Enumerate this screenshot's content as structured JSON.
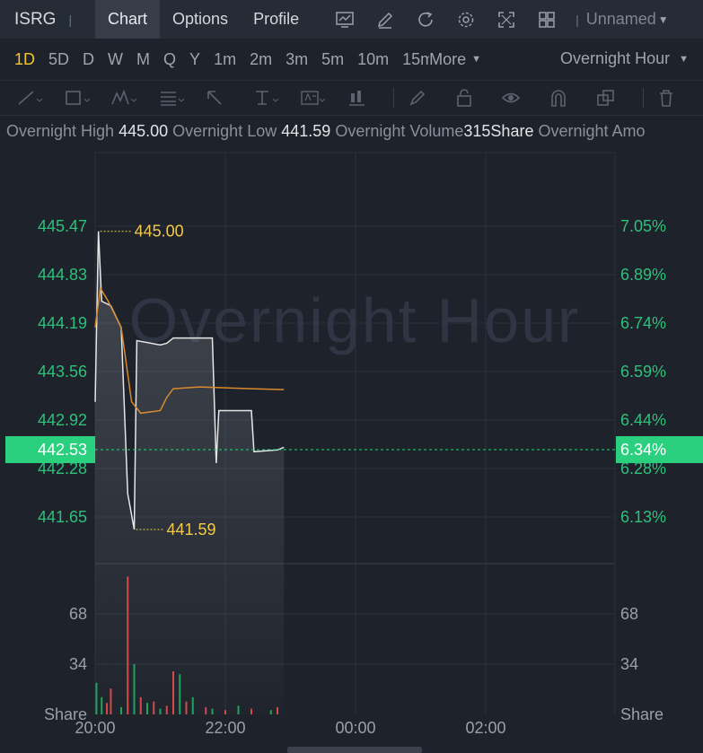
{
  "header": {
    "symbol": "ISRG",
    "tabs": [
      {
        "label": "Chart",
        "active": true
      },
      {
        "label": "Options",
        "active": false
      },
      {
        "label": "Profile",
        "active": false
      }
    ],
    "tool_icons": [
      "indicator-chart-icon",
      "pencil-icon",
      "refresh-icon",
      "settings-gear-icon",
      "fullscreen-icon",
      "layout-grid-icon"
    ],
    "layout_name": "Unnamed"
  },
  "periods": {
    "items": [
      "1D",
      "5D",
      "D",
      "W",
      "M",
      "Q",
      "Y",
      "1m",
      "2m",
      "3m",
      "5m",
      "10m",
      "15m"
    ],
    "active": "1D",
    "more_label": "More",
    "session_label": "Overnight Hour"
  },
  "drawing_tools": [
    "trend-line-icon",
    "rectangle-icon",
    "pattern-icon",
    "fibonacci-icon",
    "arrow-icon",
    "price-range-icon",
    "text-note-icon",
    "candle-marker-icon",
    "brush-icon",
    "lock-icon",
    "visibility-eye-icon",
    "magnet-icon",
    "clone-icon",
    "trash-icon"
  ],
  "info": {
    "high_label": "Overnight High",
    "high_value": "445.00",
    "low_label": "Overnight Low",
    "low_value": "441.59",
    "volume_label": "Overnight Volume",
    "volume_value": "315Share",
    "amount_label": "Overnight Amo"
  },
  "chart_data": {
    "type": "line",
    "watermark": "Overnight Hour",
    "x_ticks": [
      "20:00",
      "22:00",
      "00:00",
      "02:00"
    ],
    "price_axis_left": [
      "445.47",
      "444.83",
      "444.19",
      "443.56",
      "442.92",
      "442.28",
      "441.65"
    ],
    "percent_axis_right": [
      "7.05%",
      "6.89%",
      "6.74%",
      "6.59%",
      "6.44%",
      "6.28%",
      "6.13%"
    ],
    "ylim": [
      441.2,
      445.9
    ],
    "current_price": "442.53",
    "current_percent": "6.34%",
    "high_marker": "445.00",
    "low_marker": "441.59",
    "price_series": {
      "name": "price",
      "color": "#e6e6e6",
      "points": [
        [
          0,
          443.05
        ],
        [
          0.025,
          445.0
        ],
        [
          0.05,
          444.2
        ],
        [
          0.12,
          444.15
        ],
        [
          0.2,
          443.9
        ],
        [
          0.25,
          442.0
        ],
        [
          0.3,
          441.59
        ],
        [
          0.32,
          443.75
        ],
        [
          0.5,
          443.7
        ],
        [
          0.55,
          443.72
        ],
        [
          0.6,
          443.78
        ],
        [
          0.9,
          443.78
        ],
        [
          0.93,
          442.35
        ],
        [
          0.95,
          442.95
        ],
        [
          1.2,
          442.95
        ],
        [
          1.22,
          442.48
        ],
        [
          1.4,
          442.5
        ],
        [
          1.45,
          442.53
        ]
      ]
    },
    "avg_series": {
      "name": "average",
      "color": "#d98a2e",
      "points": [
        [
          0,
          443.9
        ],
        [
          0.04,
          444.35
        ],
        [
          0.1,
          444.2
        ],
        [
          0.2,
          443.9
        ],
        [
          0.28,
          443.05
        ],
        [
          0.35,
          442.92
        ],
        [
          0.5,
          442.95
        ],
        [
          0.55,
          443.1
        ],
        [
          0.6,
          443.2
        ],
        [
          0.8,
          443.22
        ],
        [
          1.2,
          443.2
        ],
        [
          1.45,
          443.19
        ]
      ]
    },
    "volume": {
      "axis_labels": [
        "68",
        "34"
      ],
      "unit_label": "Share",
      "ylim": [
        0,
        100
      ],
      "bars": [
        {
          "x": 0.01,
          "v": 22,
          "up": true
        },
        {
          "x": 0.05,
          "v": 12,
          "up": true
        },
        {
          "x": 0.09,
          "v": 8,
          "up": false
        },
        {
          "x": 0.12,
          "v": 18,
          "up": false
        },
        {
          "x": 0.2,
          "v": 5,
          "up": true
        },
        {
          "x": 0.25,
          "v": 96,
          "up": false
        },
        {
          "x": 0.3,
          "v": 35,
          "up": true
        },
        {
          "x": 0.35,
          "v": 12,
          "up": false
        },
        {
          "x": 0.4,
          "v": 8,
          "up": true
        },
        {
          "x": 0.45,
          "v": 9,
          "up": false
        },
        {
          "x": 0.5,
          "v": 4,
          "up": true
        },
        {
          "x": 0.55,
          "v": 6,
          "up": false
        },
        {
          "x": 0.6,
          "v": 30,
          "up": false
        },
        {
          "x": 0.65,
          "v": 28,
          "up": true
        },
        {
          "x": 0.7,
          "v": 9,
          "up": false
        },
        {
          "x": 0.75,
          "v": 12,
          "up": true
        },
        {
          "x": 0.85,
          "v": 5,
          "up": false
        },
        {
          "x": 0.9,
          "v": 4,
          "up": true
        },
        {
          "x": 1.0,
          "v": 3,
          "up": false
        },
        {
          "x": 1.1,
          "v": 6,
          "up": true
        },
        {
          "x": 1.2,
          "v": 4,
          "up": false
        },
        {
          "x": 1.35,
          "v": 3,
          "up": true
        },
        {
          "x": 1.4,
          "v": 5,
          "up": false
        }
      ]
    },
    "colors": {
      "up": "#1fa35b",
      "down": "#d24a4a",
      "axis_green": "#2fc07a",
      "marker_yellow": "#f2c94c",
      "price_tag": "#2bd07f",
      "grid": "#2c333e"
    }
  }
}
